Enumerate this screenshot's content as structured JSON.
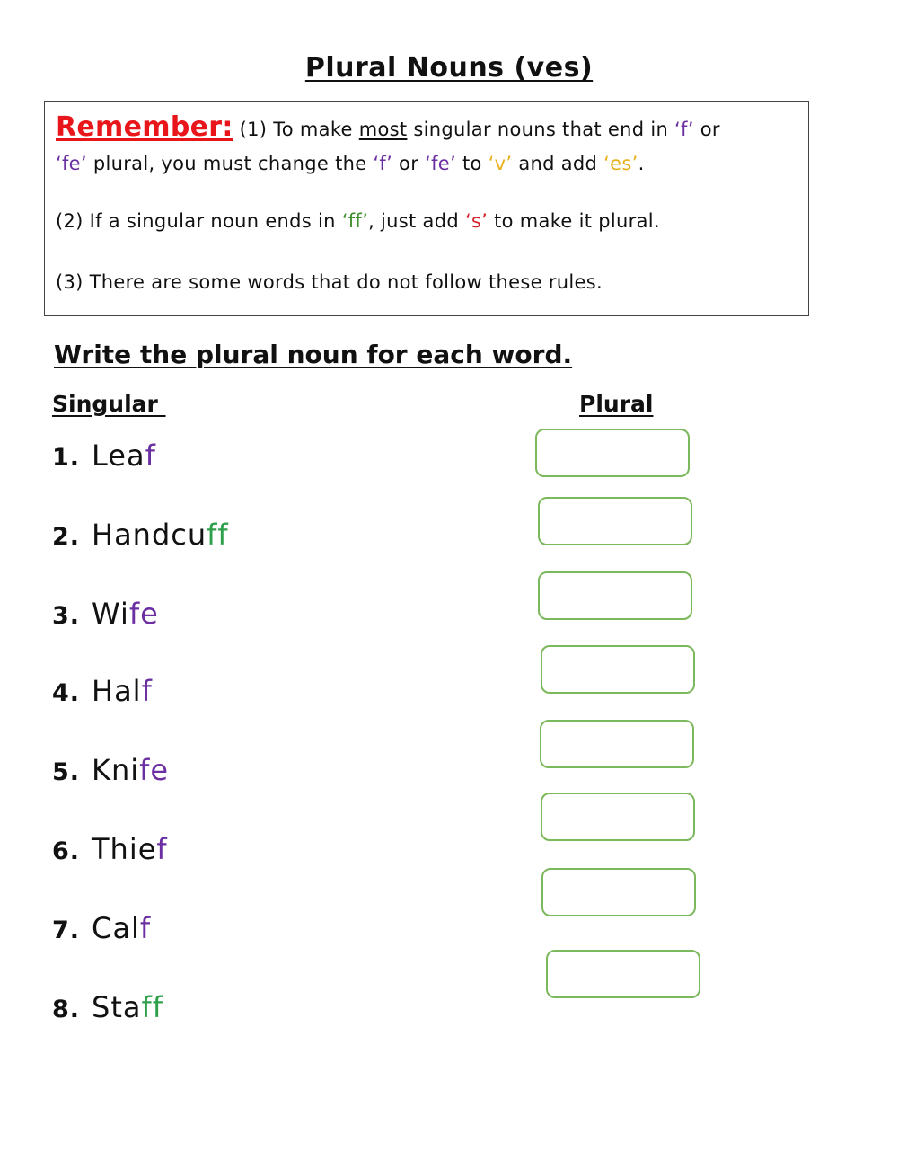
{
  "title": "Plural Nouns (ves)",
  "rules": {
    "remember_label": "Remember:",
    "rule1": {
      "part1": " (1) To make ",
      "most": "most",
      "part2": " singular nouns that end in ",
      "q_open1": "‘",
      "f": "f",
      "q_close1": "’",
      "part3": " or",
      "q_open2": "‘",
      "fe": "fe",
      "q_close2": "’",
      "part4": " plural, you must change the ",
      "q_open3": "‘",
      "f2": "f",
      "q_close3": "’",
      "part5": " or ",
      "q_open4": "‘",
      "fe2": "fe",
      "q_close4": "’",
      "part6": " to ",
      "q_open5": "‘",
      "v": "v",
      "q_close5": "’",
      "part7": " and add ",
      "q_open6": "‘",
      "es": "es",
      "q_close6": "’",
      "part8": "."
    },
    "rule2": {
      "part1": "(2) If a singular noun ends in ",
      "q_open1": "‘",
      "ff": "ff",
      "q_close1": "’",
      "part2": ", just add ",
      "q_open2": "‘",
      "s": "s",
      "q_close2": "’",
      "part3": " to make it plural."
    },
    "rule3": "(3) There are some words that do not follow these rules."
  },
  "instruction": "Write the plural noun for each word.",
  "columns": {
    "singular": "Singular ",
    "plural": "Plural"
  },
  "colors": {
    "remember": "#e8151b",
    "f_ending": "#6b2fa2",
    "ff_ending": "#2ea04b",
    "v": "#e8b01c",
    "s": "#d3212c",
    "answer_border": "#7cb85c"
  },
  "items": [
    {
      "num": "1.",
      "stem": "Lea",
      "ending": "f",
      "ending_type": "purple",
      "answer": ""
    },
    {
      "num": "2.",
      "stem": "Handcu",
      "ending": "ff",
      "ending_type": "green",
      "answer": ""
    },
    {
      "num": "3.",
      "stem": "Wi",
      "ending": "fe",
      "ending_type": "purple",
      "answer": ""
    },
    {
      "num": "4.",
      "stem": "Hal",
      "ending": "f",
      "ending_type": "purple",
      "answer": ""
    },
    {
      "num": "5.",
      "stem": "Kni",
      "ending": "fe",
      "ending_type": "purple",
      "answer": ""
    },
    {
      "num": "6.",
      "stem": "Thie",
      "ending": "f",
      "ending_type": "purple",
      "answer": ""
    },
    {
      "num": "7.",
      "stem": "Cal",
      "ending": "f",
      "ending_type": "purple",
      "answer": ""
    },
    {
      "num": "8.",
      "stem": "Sta",
      "ending": "ff",
      "ending_type": "green",
      "answer": ""
    }
  ]
}
